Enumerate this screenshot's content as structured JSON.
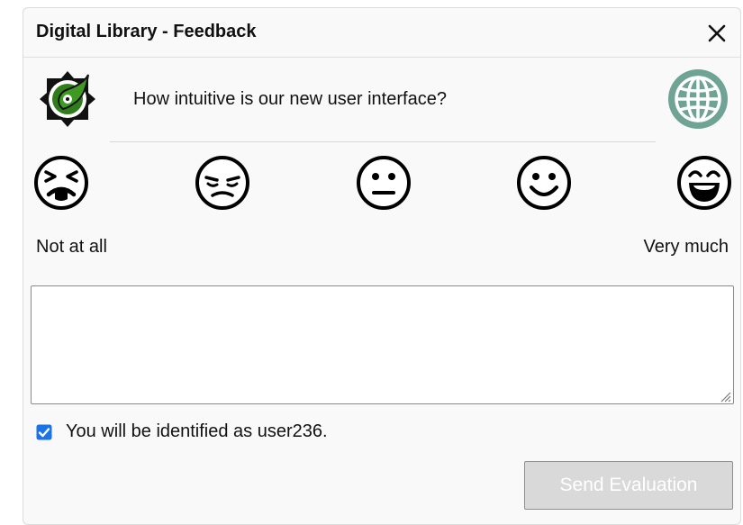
{
  "dialog": {
    "title": "Digital Library - Feedback",
    "close_icon": "close-icon"
  },
  "header_icons": {
    "logo": "compass-leaf-logo-icon",
    "globe": "globe-icon"
  },
  "question": "How intuitive is our new user interface?",
  "rating": {
    "faces": [
      {
        "name": "very-unhappy-face-icon"
      },
      {
        "name": "unhappy-face-icon"
      },
      {
        "name": "neutral-face-icon"
      },
      {
        "name": "happy-face-icon"
      },
      {
        "name": "very-happy-face-icon"
      }
    ],
    "min_label": "Not at all",
    "max_label": "Very much"
  },
  "comment": {
    "value": "",
    "placeholder": ""
  },
  "identify": {
    "checked": true,
    "label": "You will be identified as user236."
  },
  "send_button": {
    "label": "Send Evaluation",
    "disabled": true
  },
  "colors": {
    "logo_green": "#2e7d1a",
    "globe": "#6fa394",
    "checkbox": "#1a73e8"
  }
}
